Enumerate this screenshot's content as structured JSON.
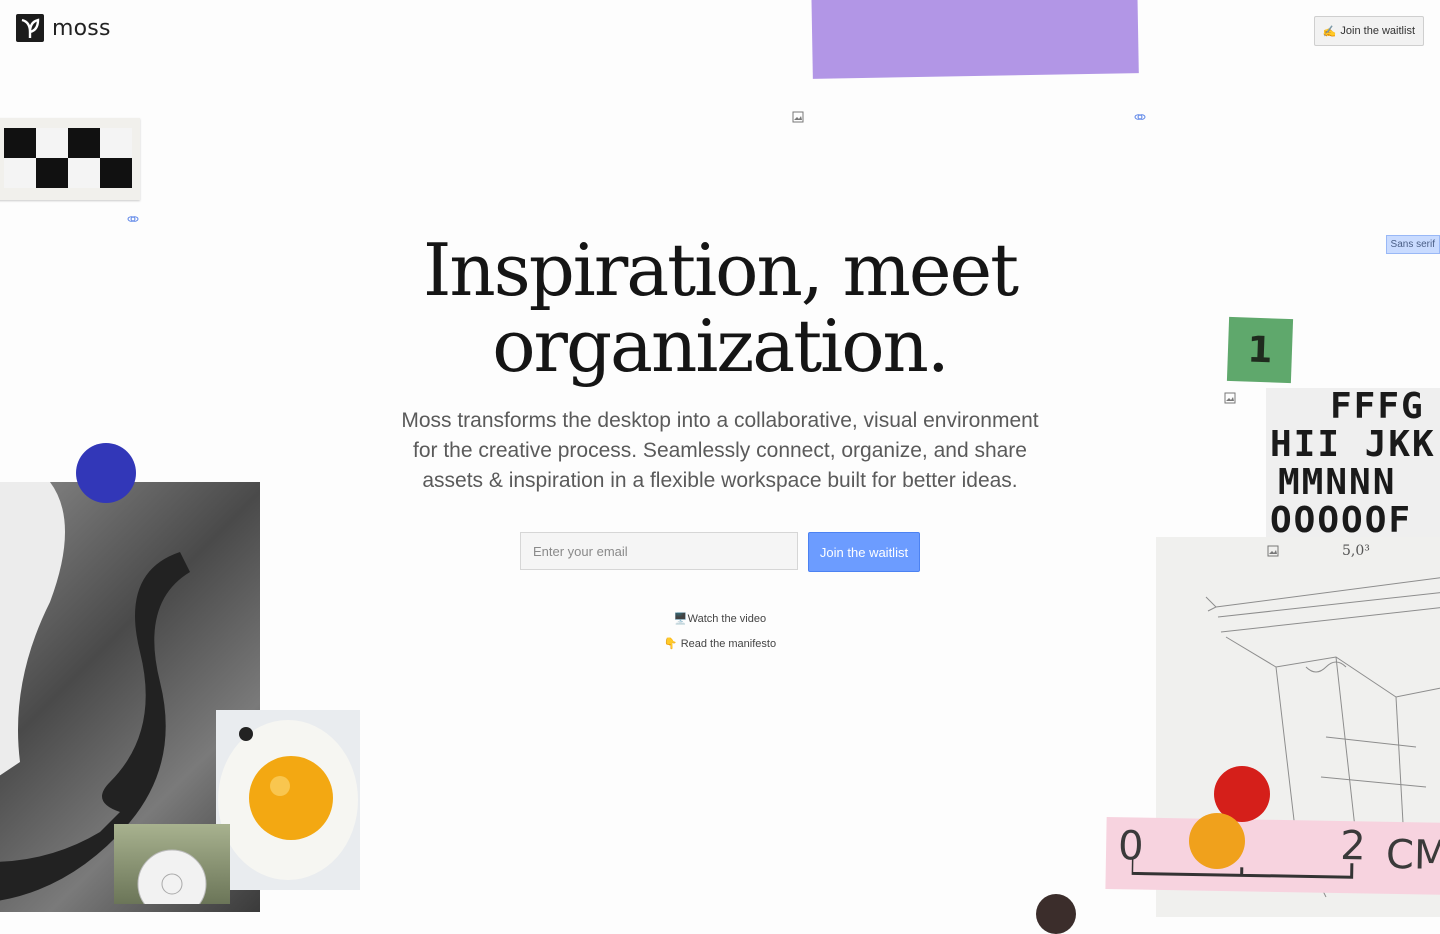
{
  "header": {
    "logo_text": "moss",
    "waitlist_button": {
      "emoji": "✍️",
      "label": "Join the waitlist"
    }
  },
  "hero": {
    "title_line1": "Inspiration, meet",
    "title_line2": "organization.",
    "subtitle_line1": "Moss transforms the desktop into a collaborative, visual environment",
    "subtitle_line2": "for the creative process. Seamlessly connect, organize, and share",
    "subtitle_line3": "assets & inspiration in a flexible workspace built for better ideas."
  },
  "signup": {
    "email_placeholder": "Enter your email",
    "join_label": "Join the waitlist"
  },
  "links": {
    "video": {
      "emoji": "🖥️",
      "label": "Watch the video"
    },
    "manifesto": {
      "emoji": "👇",
      "label": "Read the manifesto"
    }
  },
  "decor": {
    "tag_label": "Sans serif",
    "sticker_number": "1",
    "letter_rows": [
      "FFFG",
      "HII JKK",
      "MMNNN",
      "OOOOOF"
    ],
    "ruler_left": "0",
    "ruler_mid": "2",
    "ruler_right": "CM",
    "sketch_note": "5,0³"
  },
  "colors": {
    "accent": "#6c9cff",
    "purple": "#b296e6",
    "green": "#5fa86c",
    "blue_dot": "#3237b8",
    "red_dot": "#d51f1a",
    "orange_dot": "#f0a11c",
    "pink": "#f7d3df"
  },
  "icons": [
    "moss-logo-icon",
    "image-icon",
    "link-icon",
    "monitor-icon",
    "pointing-down-icon",
    "writing-hand-icon"
  ]
}
